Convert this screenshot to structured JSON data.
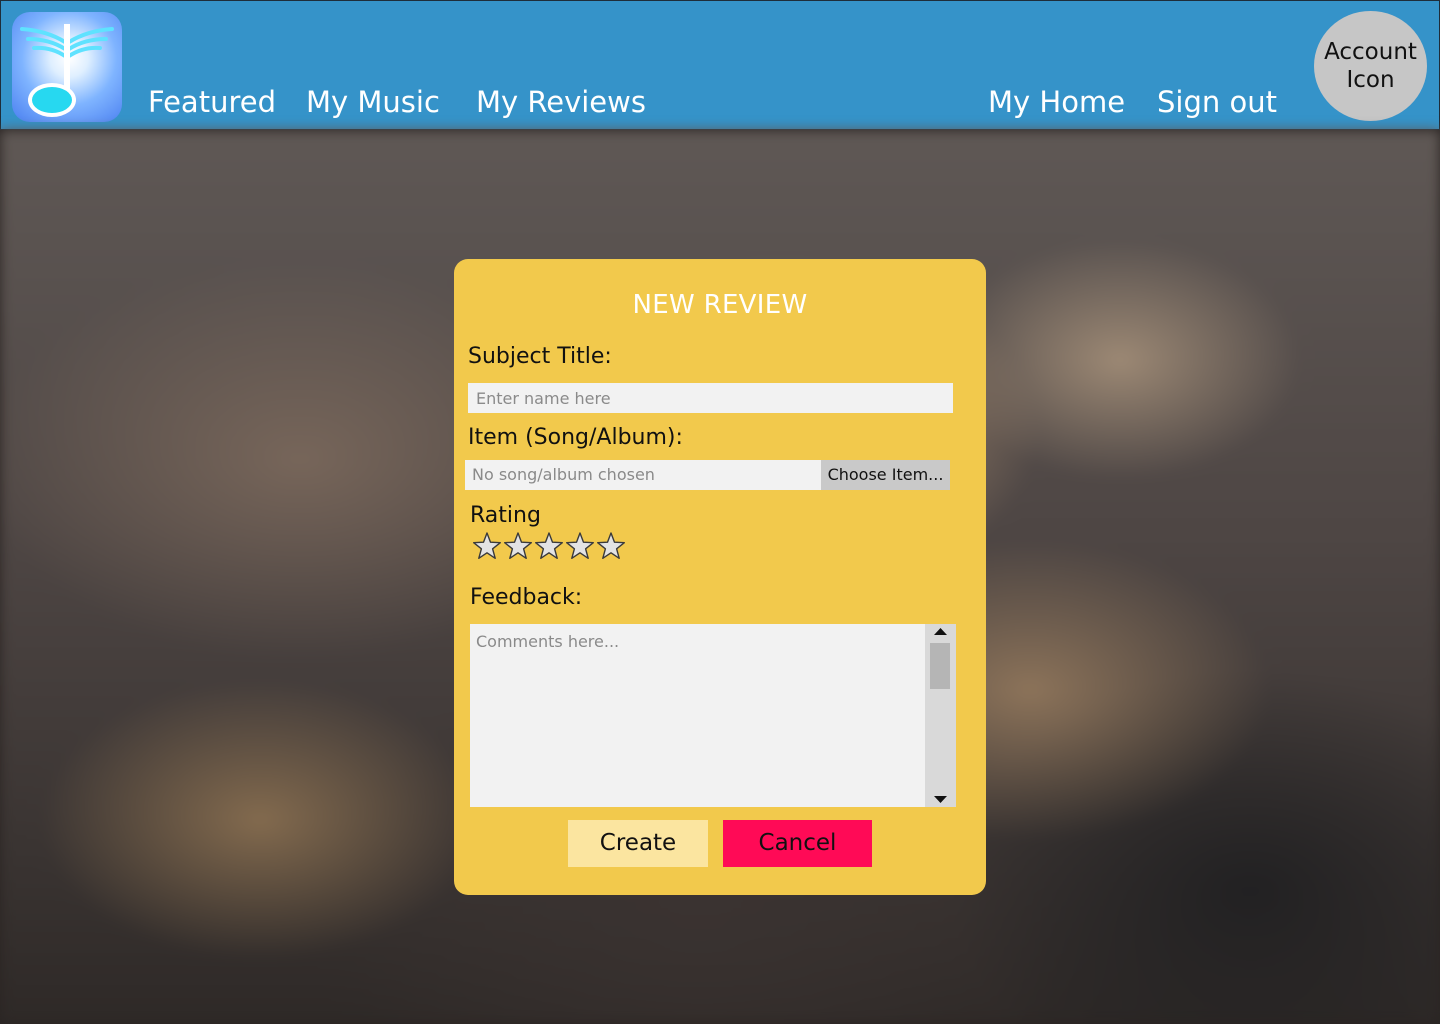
{
  "header": {
    "nav_left": [
      "Featured",
      "My Music",
      "My Reviews"
    ],
    "nav_right": [
      "My Home",
      "Sign out"
    ],
    "account_label": "Account Icon"
  },
  "dialog": {
    "title": "NEW REVIEW",
    "subject_label": "Subject Title:",
    "subject_placeholder": "Enter name here",
    "subject_value": "",
    "item_label": "Item (Song/Album):",
    "item_value": "No song/album chosen",
    "item_button": "Choose Item...",
    "rating_label": "Rating",
    "rating": {
      "value": 0,
      "max": 5
    },
    "feedback_label": "Feedback:",
    "feedback_placeholder": "Comments here...",
    "feedback_value": "",
    "create_label": "Create",
    "cancel_label": "Cancel"
  },
  "colors": {
    "header_bg": "#3593c9",
    "dialog_bg": "#f2c94c",
    "create_bg": "#fbe5a0",
    "cancel_bg": "#ff0a56",
    "input_bg": "#f2f2f2",
    "account_bg": "#c6c6c6"
  },
  "icons": {
    "logo": "winged-music-note-logo",
    "star": "star-outline-icon",
    "scroll_up": "triangle-up-icon",
    "scroll_down": "triangle-down-icon"
  }
}
